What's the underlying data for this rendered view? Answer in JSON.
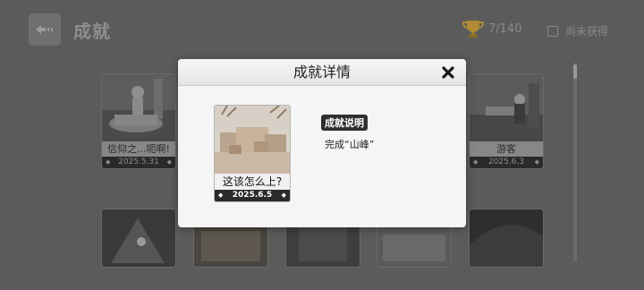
{
  "header": {
    "title": "成就",
    "trophy_count": "7/140",
    "unearned_filter_label": "尚未获得"
  },
  "cards": [
    {
      "name": "信仰之...呃啊!",
      "date": "2025.5.31"
    },
    {
      "name": "游客",
      "date": "2025.6.3"
    }
  ],
  "modal": {
    "title": "成就详情",
    "card": {
      "name": "这该怎么上?",
      "date": "2025.6.5"
    },
    "description_label": "成就说明",
    "description": "完成“山峰”"
  },
  "colors": {
    "overlay": "#5b5b5b",
    "modal_bg": "#f5f5f5",
    "label_bg": "#2f2f2f",
    "trophy": "#c9a13a"
  },
  "icons": [
    "back-arrow-icon",
    "trophy-icon",
    "close-icon",
    "marker-icon"
  ]
}
